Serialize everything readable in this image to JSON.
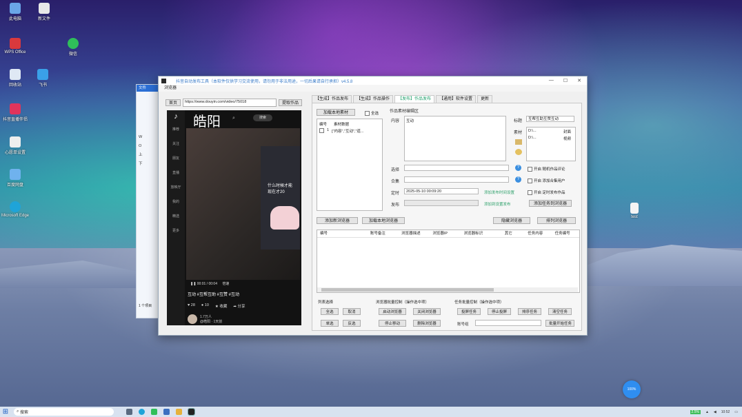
{
  "desktop": {
    "icons": [
      {
        "label": "此电脑",
        "icon": "computer-icon",
        "color": "#6aa6e8"
      },
      {
        "label": "新文件",
        "icon": "file-icon",
        "color": "#e8e8e8"
      },
      {
        "label": "WPS Office",
        "icon": "wps-icon",
        "color": "#d9393d"
      },
      {
        "label": "微信",
        "icon": "wechat-icon",
        "color": "#2fbf5a"
      },
      {
        "label": "回收站",
        "icon": "recycle-bin-icon",
        "color": "#dfe8f4"
      },
      {
        "label": "飞书",
        "icon": "feishu-icon",
        "color": "#3aa0e8"
      },
      {
        "label": "抖音直播伴侣",
        "icon": "douyin-live-icon",
        "color": "#e0345c"
      },
      {
        "label": "心愿单设置",
        "icon": "doc-icon",
        "color": "#eeeeee"
      },
      {
        "label": "百度网盘",
        "icon": "baidu-netdisk-icon",
        "color": "#6fb2ee"
      },
      {
        "label": "Microsoft Edge",
        "icon": "edge-icon",
        "color": "#1fa4d8"
      }
    ],
    "right_file": "test"
  },
  "explorer": {
    "tab": "文件",
    "drives": [
      "W",
      "O",
      "上",
      "下"
    ],
    "count": "1 个项目"
  },
  "window": {
    "title": "抖音自动发布工具（本软件仅供学习交流使用，请勿用于非法用途，一切后果请自行承担）v4.5.8",
    "menu": "浏览器",
    "browser": {
      "home_btn": "首页",
      "url": "https://www.douyin.com/video/75018",
      "fetch_btn": "提取作品",
      "overlay_name": "皓阳",
      "search_btn": "搜索",
      "sidebar": [
        "推荐",
        "关注",
        "朋友",
        "直播",
        "放映厅",
        "我的",
        "精选",
        "更多"
      ],
      "video_text": [
        "什么时候才能",
        "现在才20"
      ],
      "time": "00:01 / 00:04",
      "speed": "倍速",
      "tags": "互动 #互帮互助 #互赞 #互动",
      "likes": "28",
      "comments": "10",
      "favorites": "收藏",
      "share": "分享",
      "author": "1.7万人",
      "author_sub": "@皓阳 · 1天前"
    },
    "tabs": [
      "【生成】作品发布",
      "【生成】作品操作",
      "【发布】作品发布",
      "【通用】软件设置",
      "更新"
    ],
    "active_tab": 2,
    "publish": {
      "add_material_btn": "加载本地素材",
      "all_checkbox": "全选",
      "list_headers": [
        "编号",
        "素材数据"
      ],
      "list_rows": [
        {
          "no": "1",
          "data": "[\"内容\",\"互动\",\"道..."
        }
      ],
      "batch_title": "作品素材编辑区",
      "content_label": "内容",
      "content_value": "互动",
      "title_label": "标题",
      "title_value": "互帮互助互赞互动",
      "material_label": "素材",
      "materials": [
        {
          "path": "D:\\...",
          "type": "封面"
        },
        {
          "path": "D:\\...",
          "type": "视频"
        }
      ],
      "location_label": "选择",
      "collection_label": "合集",
      "schedule_label": "定时",
      "schedule_value": "2025-05-10 00:09:20",
      "visibility_label": "发布",
      "opt_comment": "开启 随机作品评论",
      "opt_collection": "开启 添加合集用户",
      "opt_schedule": "开启 定时发布作品",
      "green_schedule": "添加发布时间设置",
      "green_visibility": "添加到设置发布",
      "add_to_browser_btn": "添加任务到浏览器"
    },
    "browser_list": {
      "add_btn": "添加新浏览器",
      "load_btn": "加载本地浏览器",
      "hide_btn": "隐藏浏览器",
      "sort_btn": "排列浏览器",
      "headers": [
        "编号",
        "账号备注",
        "浏览器描述",
        "浏览器IP",
        "浏览器标识",
        "其它",
        "任务内容",
        "任务编号"
      ]
    },
    "groups": {
      "list_select": "列表选择",
      "list_buttons": [
        "全选",
        "取消",
        "单选",
        "反选"
      ],
      "batch_control": "浏览器批量控制（操作选中项）",
      "batch_buttons": [
        "启动浏览器",
        "关闭浏览器",
        "停止移动",
        "删除浏览器"
      ],
      "task_control": "任务批量控制（操作选中项）",
      "task_buttons": [
        "投屏任务",
        "停止投屏",
        "排序任务",
        "清空任务"
      ],
      "account_label": "账号组",
      "start_task_btn": "批量开始任务"
    }
  },
  "taskbar": {
    "search": "搜索",
    "clock": "10:52",
    "battery": "2.5%"
  },
  "floating_badge": "100%"
}
